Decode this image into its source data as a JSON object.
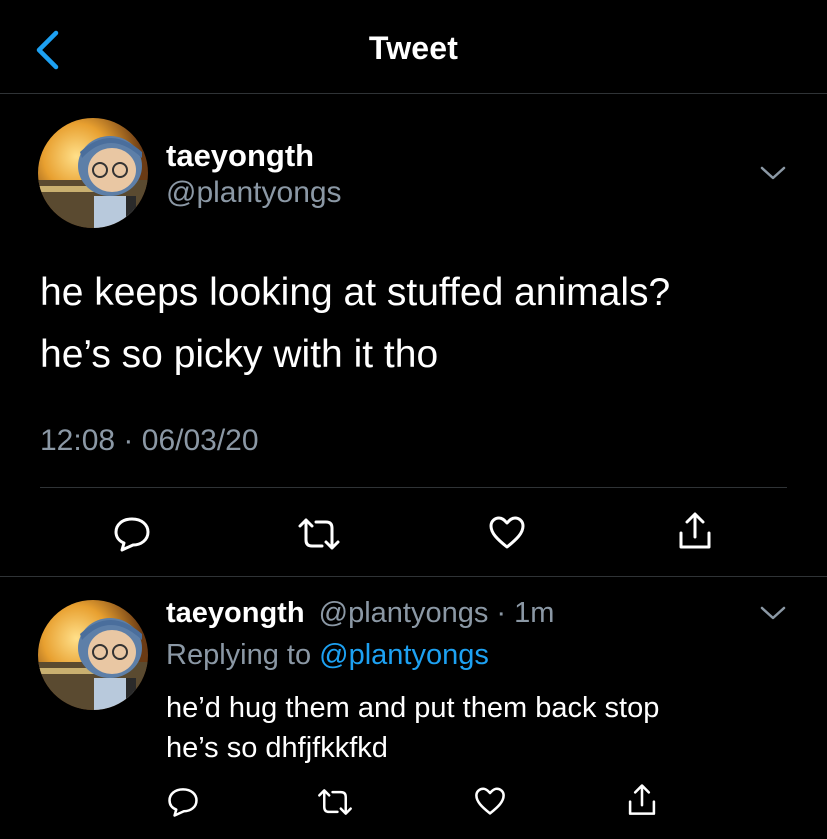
{
  "header": {
    "title": "Tweet",
    "back_icon": "chevron-left-icon",
    "accent": "#1da1f2"
  },
  "tweet": {
    "display_name": "taeyongth",
    "handle": "@plantyongs",
    "text_line1": "he keeps looking at stuffed animals?",
    "text_line2": "he’s so picky with it tho",
    "time": "12:08",
    "separator": "·",
    "date": "06/03/20",
    "actions": [
      "reply-icon",
      "retweet-icon",
      "like-icon",
      "share-icon"
    ]
  },
  "reply": {
    "display_name": "taeyongth",
    "handle": "@plantyongs",
    "separator": "·",
    "age": "1m",
    "replying_prefix": "Replying to",
    "replying_handle": "@plantyongs",
    "text_line1": "he’d hug them and put them back stop",
    "text_line2": "he’s so dhfjfkkfkd",
    "actions": [
      "reply-icon",
      "retweet-icon",
      "like-icon",
      "share-icon"
    ]
  },
  "colors": {
    "background": "#000000",
    "muted": "#8b98a5",
    "link": "#1da1f2",
    "divider": "#2f3336"
  }
}
